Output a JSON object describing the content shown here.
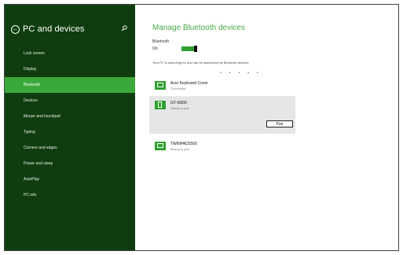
{
  "sidebar": {
    "title": "PC and devices",
    "items": [
      {
        "label": "Lock screen",
        "selected": false
      },
      {
        "label": "Display",
        "selected": false
      },
      {
        "label": "Bluetooth",
        "selected": true
      },
      {
        "label": "Devices",
        "selected": false
      },
      {
        "label": "Mouse and touchpad",
        "selected": false
      },
      {
        "label": "Typing",
        "selected": false
      },
      {
        "label": "Corners and edges",
        "selected": false
      },
      {
        "label": "Power and sleep",
        "selected": false
      },
      {
        "label": "AutoPlay",
        "selected": false
      },
      {
        "label": "PC info",
        "selected": false
      }
    ]
  },
  "main": {
    "title": "Manage Bluetooth devices",
    "bluetooth_label": "Bluetooth",
    "bluetooth_state": "On",
    "info_text": "Your PC is searching for and can be discovered by Bluetooth devices.",
    "devices": [
      {
        "name": "Acer Keyboard Cover",
        "status": "Connected",
        "icon": "keyboard-icon"
      },
      {
        "name": "GT-I9300",
        "status": "Ready to pair",
        "icon": "phone-icon",
        "action": "Pair"
      },
      {
        "name": "TWINPAD2500",
        "status": "Ready to pair",
        "icon": "device-icon"
      }
    ]
  },
  "colors": {
    "sidebar_bg": "#0f3d0f",
    "accent": "#3aa83a",
    "title_green": "#4aa84a",
    "toggle": "#2f9f2f"
  }
}
